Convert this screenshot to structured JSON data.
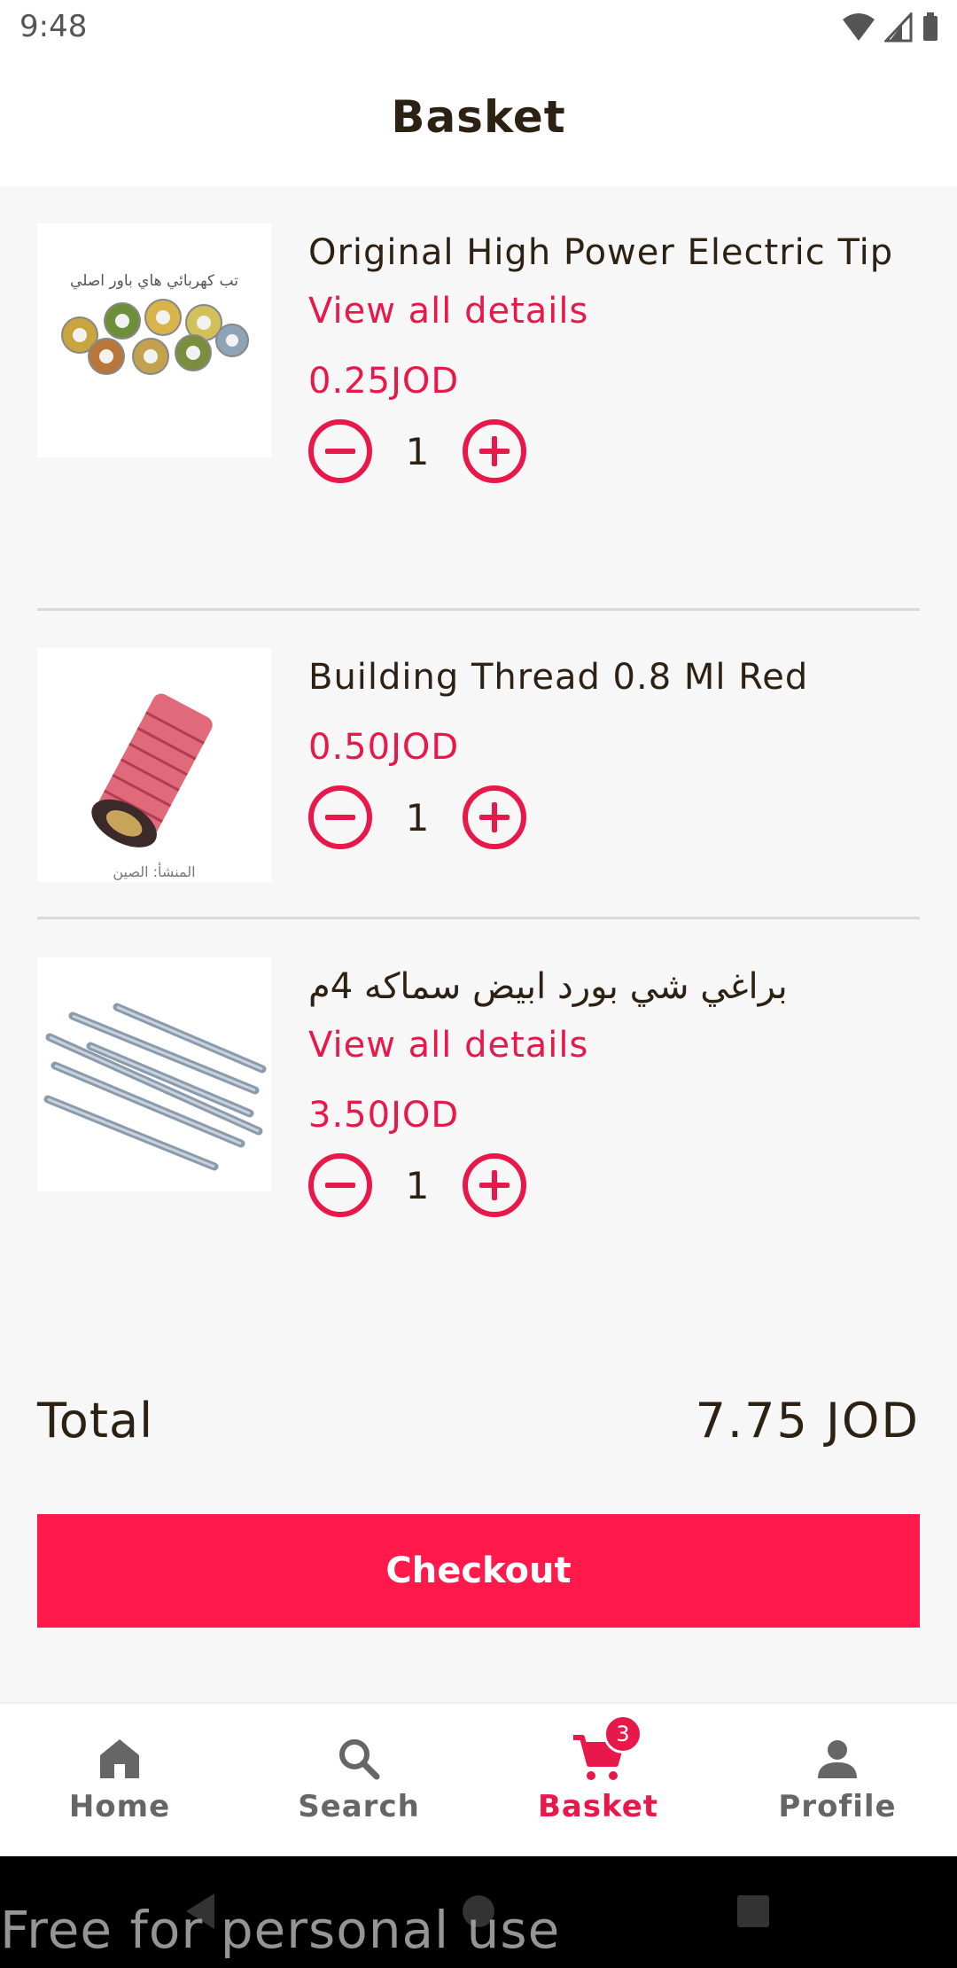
{
  "status_bar": {
    "time": "9:48"
  },
  "header": {
    "title": "Basket"
  },
  "items": [
    {
      "name": "Original High Power Electric Tip",
      "view_details": "View all details",
      "price": "0.25JOD",
      "quantity": "1",
      "image_caption": "تب كهربائي هاي باور اصلي"
    },
    {
      "name": "Building Thread 0.8 Ml Red",
      "price": "0.50JOD",
      "quantity": "1",
      "image_caption": "المنشأ: الصين"
    },
    {
      "name": "براغي شي بورد ابيض سماكه 4م",
      "view_details": "View all details",
      "price": "3.50JOD",
      "quantity": "1"
    }
  ],
  "total": {
    "label": "Total",
    "value": "7.75 JOD"
  },
  "checkout": {
    "label": "Checkout"
  },
  "bottom_nav": {
    "items": [
      {
        "label": "Home",
        "icon": "home-icon"
      },
      {
        "label": "Search",
        "icon": "search-icon"
      },
      {
        "label": "Basket",
        "icon": "cart-icon",
        "badge": "3",
        "active": true
      },
      {
        "label": "Profile",
        "icon": "person-icon"
      }
    ]
  },
  "watermark": "Free for personal use",
  "colors": {
    "accent": "#e8194a",
    "checkout": "#ff1a4b",
    "text": "#2c2113"
  }
}
